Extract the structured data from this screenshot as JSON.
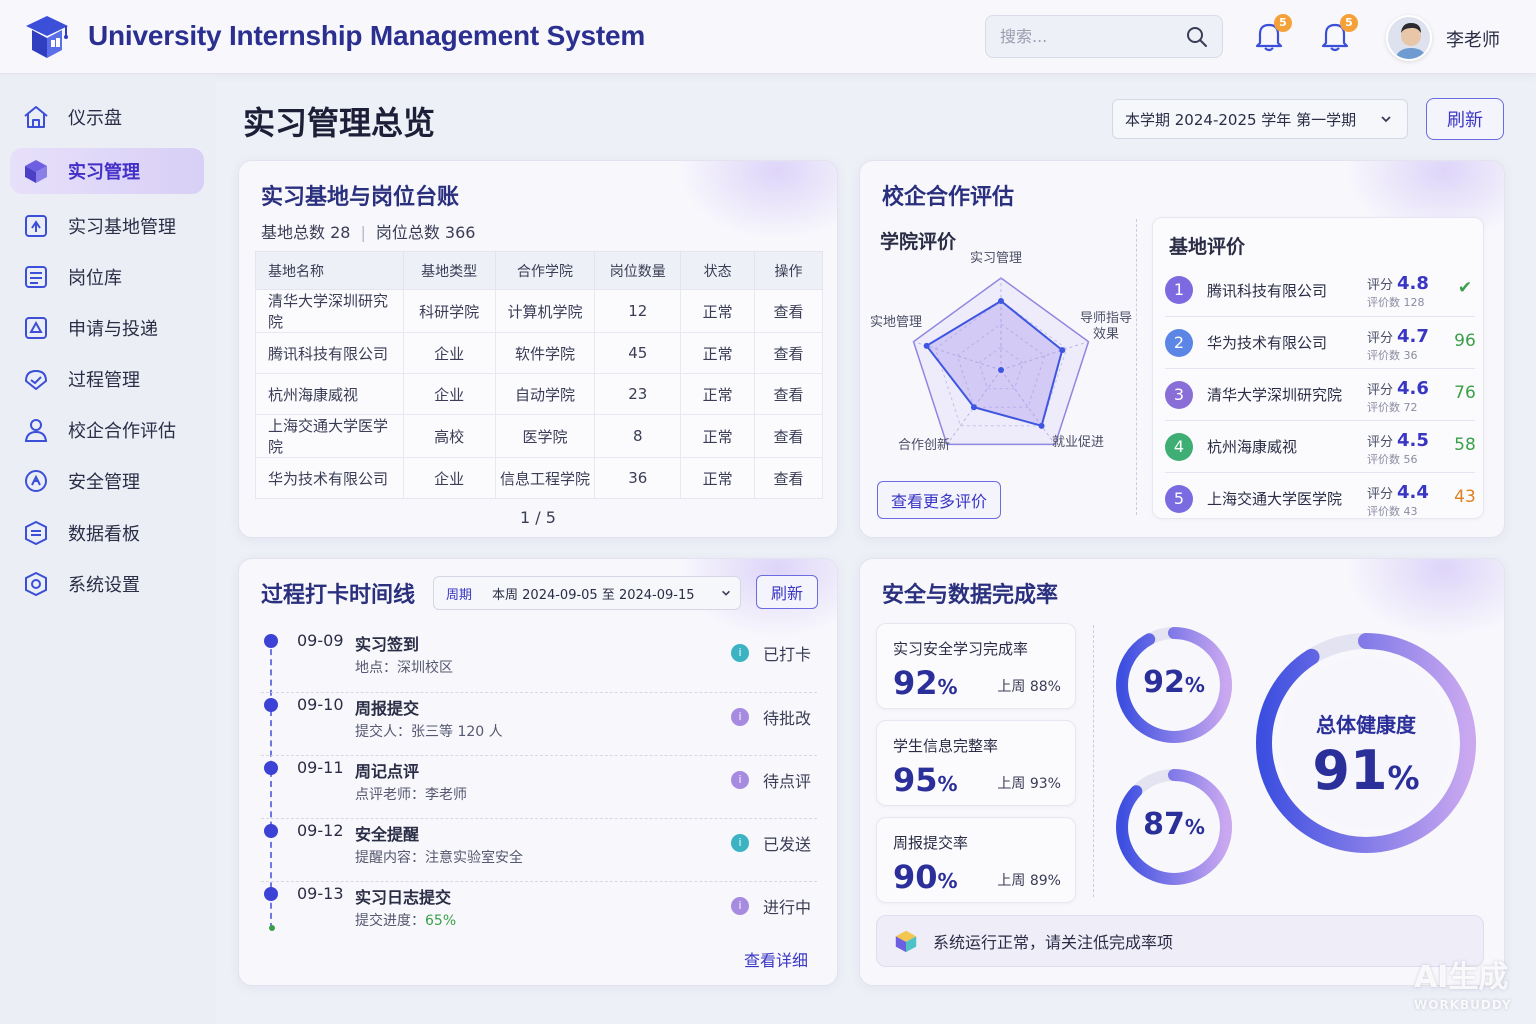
{
  "header": {
    "app_title": "University Internship Management System",
    "search_placeholder": "搜索...",
    "notifications": [
      {
        "count": "5"
      },
      {
        "count": "5"
      }
    ],
    "user_name": "李老师"
  },
  "sidebar": {
    "items": [
      {
        "label": "仪示盘",
        "icon": "home-icon"
      },
      {
        "label": "实习管理",
        "icon": "cube-icon",
        "active": true
      },
      {
        "label": "实习基地管理",
        "icon": "base-icon"
      },
      {
        "label": "岗位库",
        "icon": "job-library-icon"
      },
      {
        "label": "申请与投递",
        "icon": "apply-icon"
      },
      {
        "label": "过程管理",
        "icon": "process-icon"
      },
      {
        "label": "校企合作评估",
        "icon": "user-icon"
      },
      {
        "label": "安全管理",
        "icon": "safety-icon"
      },
      {
        "label": "数据看板",
        "icon": "dashboard-icon"
      },
      {
        "label": "系统设置",
        "icon": "settings-icon"
      }
    ]
  },
  "page": {
    "title": "实习管理总览",
    "term_select": "本学期 2024-2025 学年 第一学期",
    "refresh_label": "刷新"
  },
  "ledger": {
    "title": "实习基地与岗位台账",
    "base_count_label": "基地总数 28",
    "position_count_label": "岗位总数 366",
    "columns": [
      "基地名称",
      "基地类型",
      "合作学院",
      "岗位数量",
      "状态",
      "操作"
    ],
    "rows": [
      {
        "name": "清华大学深圳研究院",
        "type": "科研学院",
        "college": "计算机学院",
        "count": "12",
        "status": "正常",
        "action": "查看"
      },
      {
        "name": "腾讯科技有限公司",
        "type": "企业",
        "college": "软件学院",
        "count": "45",
        "status": "正常",
        "action": "查看"
      },
      {
        "name": "杭州海康威视",
        "type": "企业",
        "college": "自动学院",
        "count": "23",
        "status": "正常",
        "action": "查看"
      },
      {
        "name": "上海交通大学医学院",
        "type": "高校",
        "college": "医学院",
        "count": "8",
        "status": "正常",
        "action": "查看"
      },
      {
        "name": "华为技术有限公司",
        "type": "企业",
        "college": "信息工程学院",
        "count": "36",
        "status": "正常",
        "action": "查看"
      }
    ],
    "pager": "1 / 5"
  },
  "evaluation": {
    "title": "校企合作评估",
    "college_eval_title": "学院评价",
    "radar_labels": [
      "实习管理",
      "导师指导\n效果",
      "就业促进",
      "合作创新",
      "实地管理"
    ],
    "radar_values": [
      0.75,
      0.7,
      0.75,
      0.5,
      0.85
    ],
    "more_button": "查看更多评价",
    "base_eval_title": "基地评价",
    "ranking": [
      {
        "rank": "1",
        "name": "腾讯科技有限公司",
        "score_label": "评分",
        "score": "4.8",
        "count": "评价数 128",
        "value": "✔",
        "value_color": "#3aa048",
        "badge_color": "#7d6ae0"
      },
      {
        "rank": "2",
        "name": "华为技术有限公司",
        "score_label": "评分",
        "score": "4.7",
        "count": "评价数 36",
        "value": "96",
        "value_color": "#3aa048",
        "badge_color": "#5b86e5"
      },
      {
        "rank": "3",
        "name": "清华大学深圳研究院",
        "score_label": "评分",
        "score": "4.6",
        "count": "评价数 72",
        "value": "76",
        "value_color": "#3aa048",
        "badge_color": "#8a6ed8"
      },
      {
        "rank": "4",
        "name": "杭州海康威视",
        "score_label": "评分",
        "score": "4.5",
        "count": "评价数 56",
        "value": "58",
        "value_color": "#3aa048",
        "badge_color": "#3fae74"
      },
      {
        "rank": "5",
        "name": "上海交通大学医学院",
        "score_label": "评分",
        "score": "4.4",
        "count": "评价数 43",
        "value": "43",
        "value_color": "#e0801f",
        "badge_color": "#7a6be0"
      }
    ]
  },
  "timeline": {
    "title": "过程打卡时间线",
    "period_label": "周期",
    "period_value": "本周 2024-09-05 至 2024-09-15",
    "refresh_label": "刷新",
    "items": [
      {
        "date": "09-09",
        "event": "实习签到",
        "detail": "地点：深圳校区",
        "status": "已打卡",
        "status_color": "#3bb3c3"
      },
      {
        "date": "09-10",
        "event": "周报提交",
        "detail": "提交人：张三等 120 人",
        "status": "待批改",
        "status_color": "#a78be0"
      },
      {
        "date": "09-11",
        "event": "周记点评",
        "detail": "点评老师：李老师",
        "status": "待点评",
        "status_color": "#a78be0"
      },
      {
        "date": "09-12",
        "event": "安全提醒",
        "detail": "提醒内容：注意实验室安全",
        "status": "已发送",
        "status_color": "#3bb3c3"
      },
      {
        "date": "09-13",
        "event": "实习日志提交",
        "detail_prefix": "提交进度：",
        "detail_value": "65%",
        "status": "进行中",
        "status_color": "#a78be0"
      }
    ],
    "view_detail": "查看详细"
  },
  "safety": {
    "title": "安全与数据完成率",
    "kpis": [
      {
        "label": "实习安全学习完成率",
        "value": "92",
        "unit": "%",
        "last": "上周 88%"
      },
      {
        "label": "学生信息完整率",
        "value": "95",
        "unit": "%",
        "last": "上周 93%"
      },
      {
        "label": "周报提交率",
        "value": "90",
        "unit": "%",
        "last": "上周 89%"
      }
    ],
    "donuts": [
      {
        "value": "92",
        "unit": "%",
        "fraction": 0.92
      },
      {
        "value": "87",
        "unit": "%",
        "fraction": 0.87
      }
    ],
    "overall": {
      "label": "总体健康度",
      "value": "91",
      "unit": "%",
      "fraction": 0.91
    },
    "notice": "系统运行正常，请关注低完成率项"
  },
  "watermark": {
    "line1": "AI生成",
    "line2": "WORKBUDDY"
  },
  "colors": {
    "accent": "#3a36c4",
    "brand": "#2b2f8f",
    "ok": "#3aa048",
    "warn": "#e0801f"
  }
}
